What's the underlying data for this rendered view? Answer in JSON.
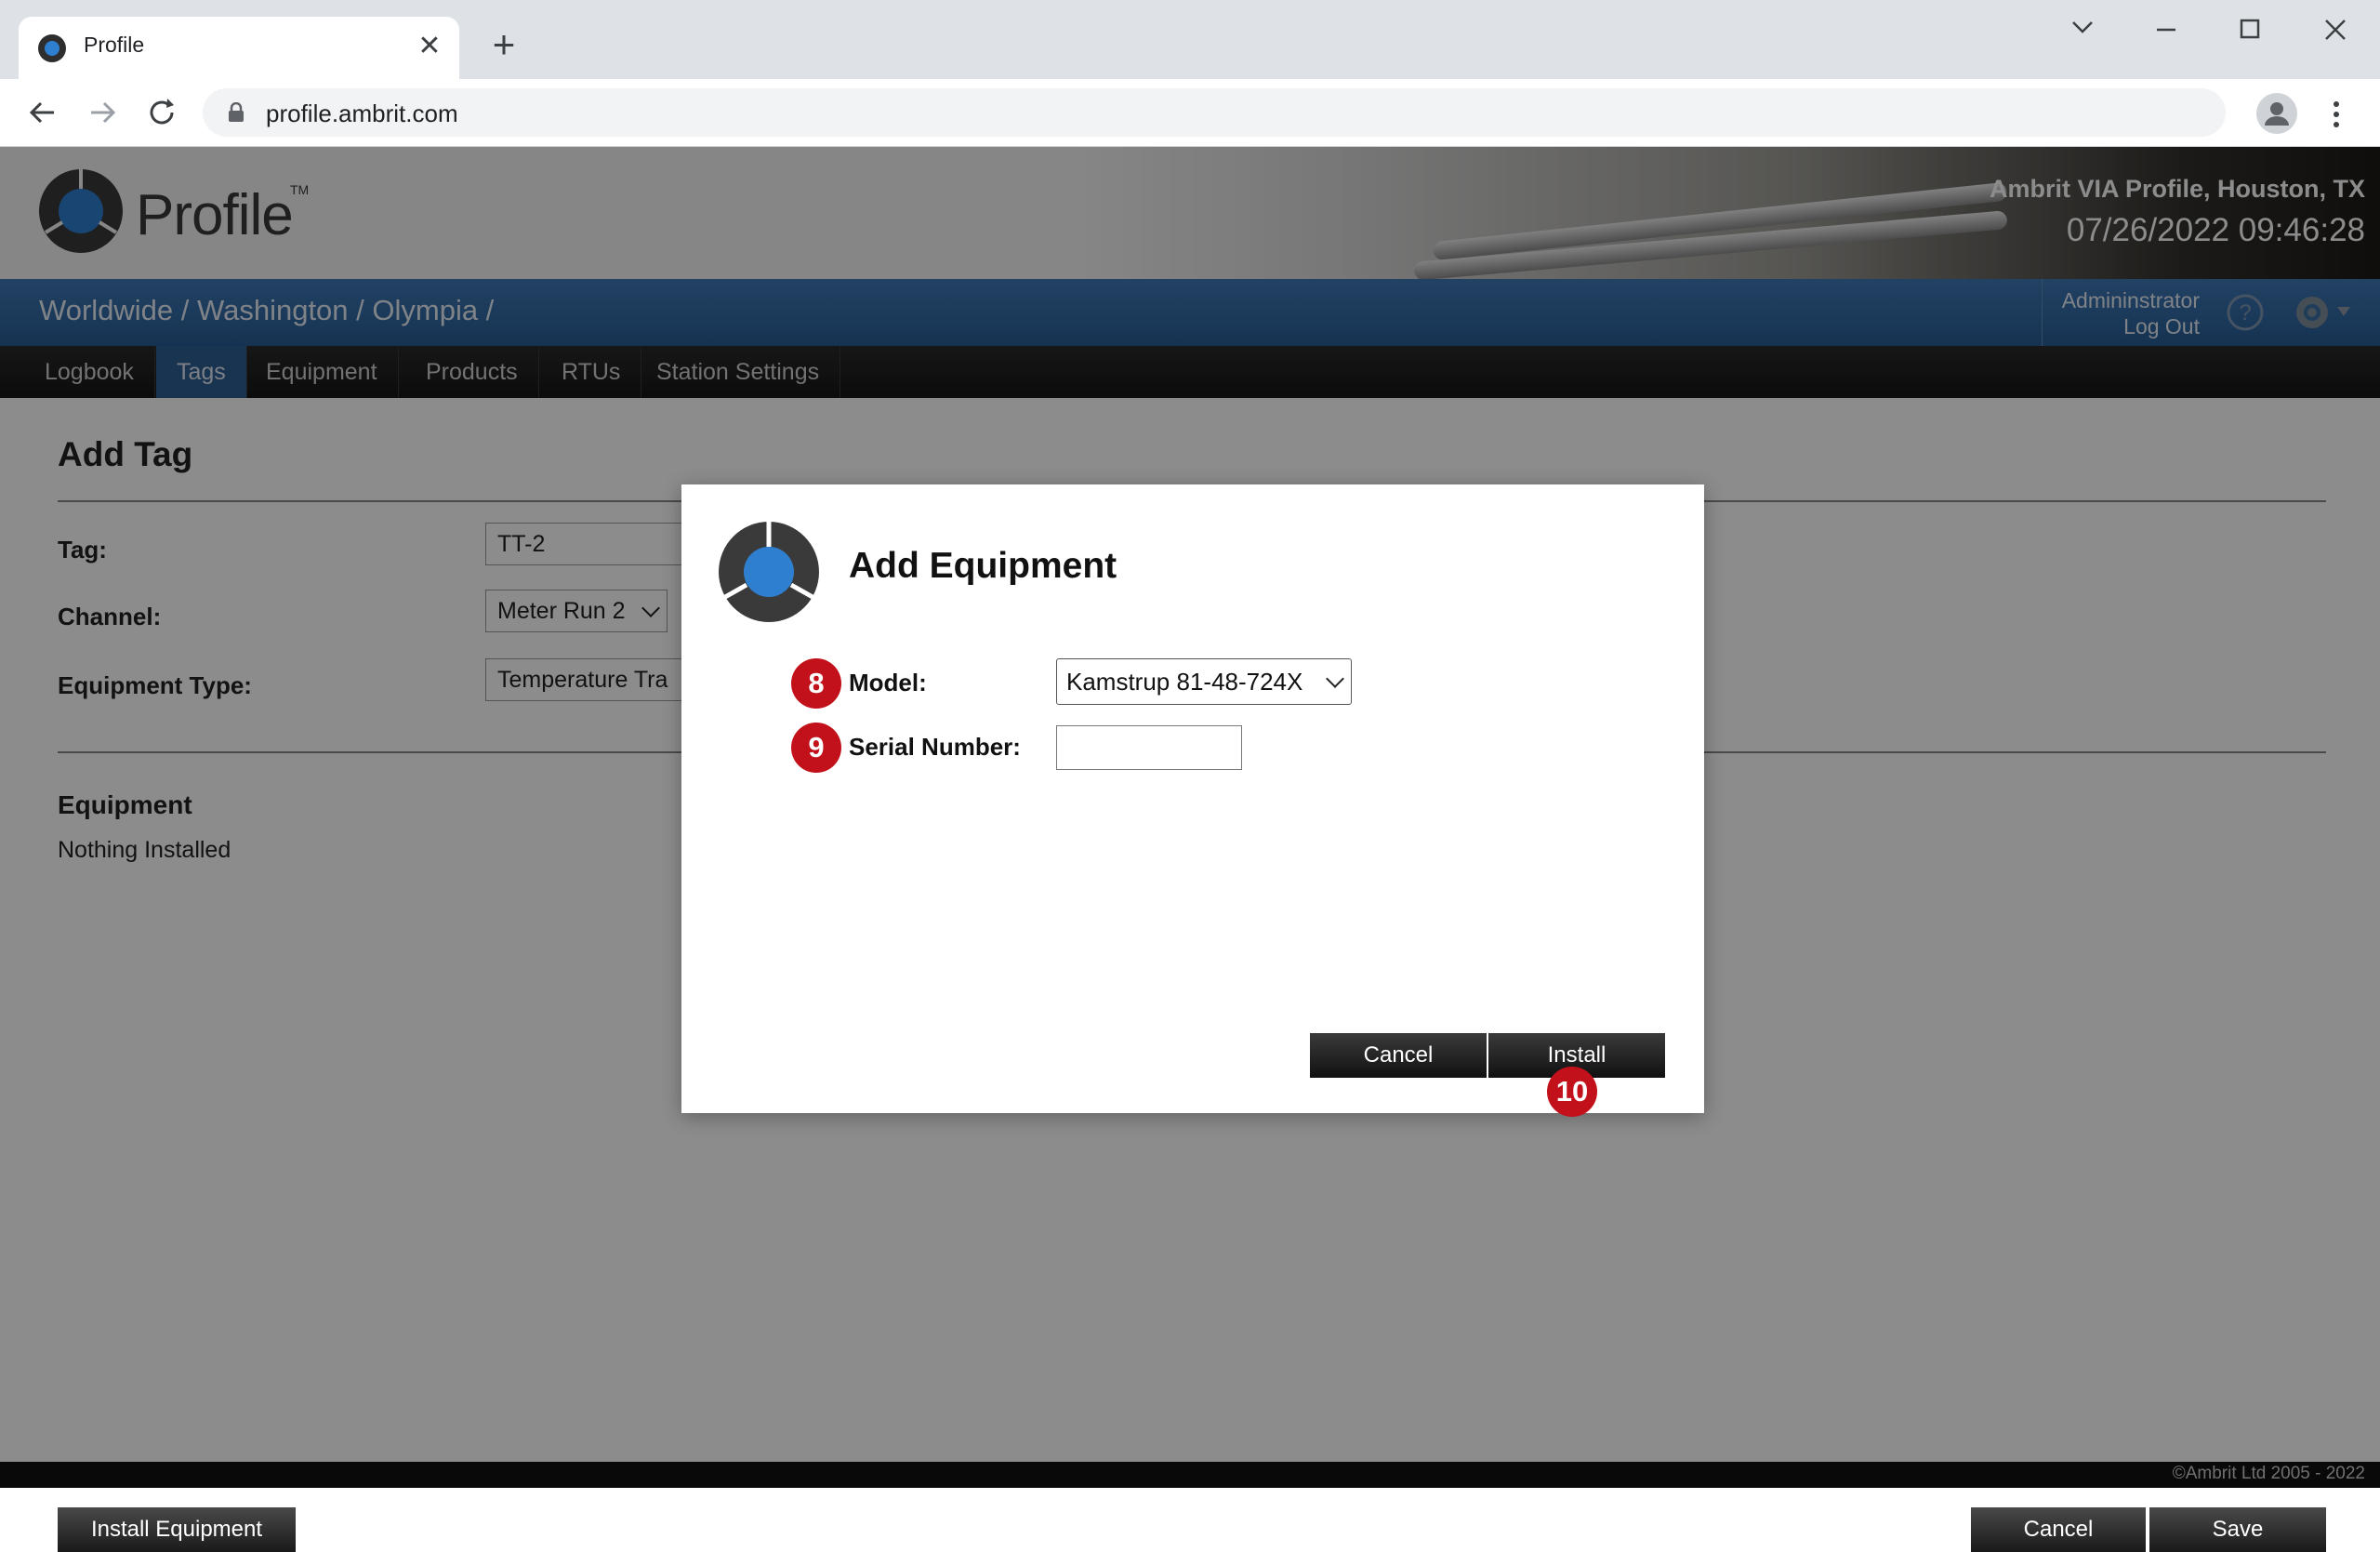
{
  "browser": {
    "tab_title": "Profile",
    "tab_close": "✕",
    "new_tab": "+",
    "url": "profile.ambrit.com"
  },
  "header": {
    "logo_text": "Profile",
    "logo_tm": "TM",
    "site_name": "Ambrit VIA Profile, Houston, TX",
    "datetime": "07/26/2022 09:46:28"
  },
  "bluebar": {
    "breadcrumb": "Worldwide / Washington / Olympia /",
    "user": "Admininstrator",
    "logout": "Log Out"
  },
  "nav": {
    "items": [
      {
        "label": "Logbook"
      },
      {
        "label": "Tags"
      },
      {
        "label": "Equipment"
      },
      {
        "label": "Products"
      },
      {
        "label": "RTUs"
      },
      {
        "label": "Station Settings"
      }
    ],
    "active": "Tags"
  },
  "form": {
    "title": "Add Tag",
    "tag_label": "Tag:",
    "tag_value": "TT-2",
    "channel_label": "Channel:",
    "channel_value": "Meter Run 2",
    "equipment_type_label": "Equipment Type:",
    "equipment_type_value": "Temperature Tra",
    "equipment_section_title": "Equipment",
    "equipment_section_text": "Nothing Installed",
    "install_equipment_button": "Install Equipment",
    "cancel_button": "Cancel",
    "save_button": "Save"
  },
  "footer": {
    "copyright": "©Ambrit Ltd 2005 - 2022"
  },
  "modal": {
    "title": "Add Equipment",
    "model_label": "Model:",
    "model_value": "Kamstrup 81-48-724X",
    "serial_label": "Serial Number:",
    "serial_value": "",
    "cancel_button": "Cancel",
    "install_button": "Install",
    "steps": {
      "model": "8",
      "serial": "9",
      "install": "10"
    }
  },
  "colors": {
    "accent_blue": "#2e5f94",
    "step_red": "#c2111b"
  }
}
